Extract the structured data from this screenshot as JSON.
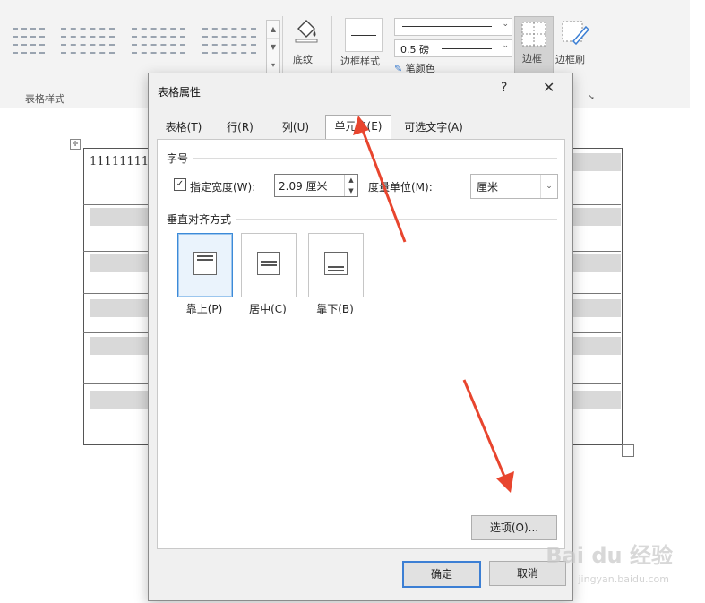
{
  "ribbon": {
    "group_table_styles_label": "表格样式",
    "shading_label": "底纹",
    "border_styles_label": "边框样式",
    "border_weight": "0.5 磅",
    "pen_color_label": "笔颜色",
    "borders_label": "边框",
    "border_painter_label": "边框刷"
  },
  "document": {
    "cell_text": "11111111"
  },
  "dialog": {
    "title": "表格属性",
    "help": "?",
    "close": "✕",
    "tabs": [
      {
        "label": "表格(T)"
      },
      {
        "label": "行(R)"
      },
      {
        "label": "列(U)"
      },
      {
        "label": "单元格(E)"
      },
      {
        "label": "可选文字(A)"
      }
    ],
    "active_tab": "单元格(E)",
    "size_section": "字号",
    "preferred_width_label": "指定宽度(W):",
    "preferred_width_checked": "✓",
    "preferred_width_value": "2.09 厘米",
    "measure_in_label": "度量单位(M):",
    "measure_in_value": "厘米",
    "vertical_align_section": "垂直对齐方式",
    "align_top_label": "靠上(P)",
    "align_center_label": "居中(C)",
    "align_bottom_label": "靠下(B)",
    "options_button": "选项(O)...",
    "ok_button": "确定",
    "cancel_button": "取消"
  },
  "watermark": {
    "brand": "Bai du 经验",
    "url": "jingyan.baidu.com"
  },
  "colors": {
    "arrow": "#e8452e",
    "selected_border": "#3c8ad8",
    "default_button_border": "#3c7fd4"
  }
}
